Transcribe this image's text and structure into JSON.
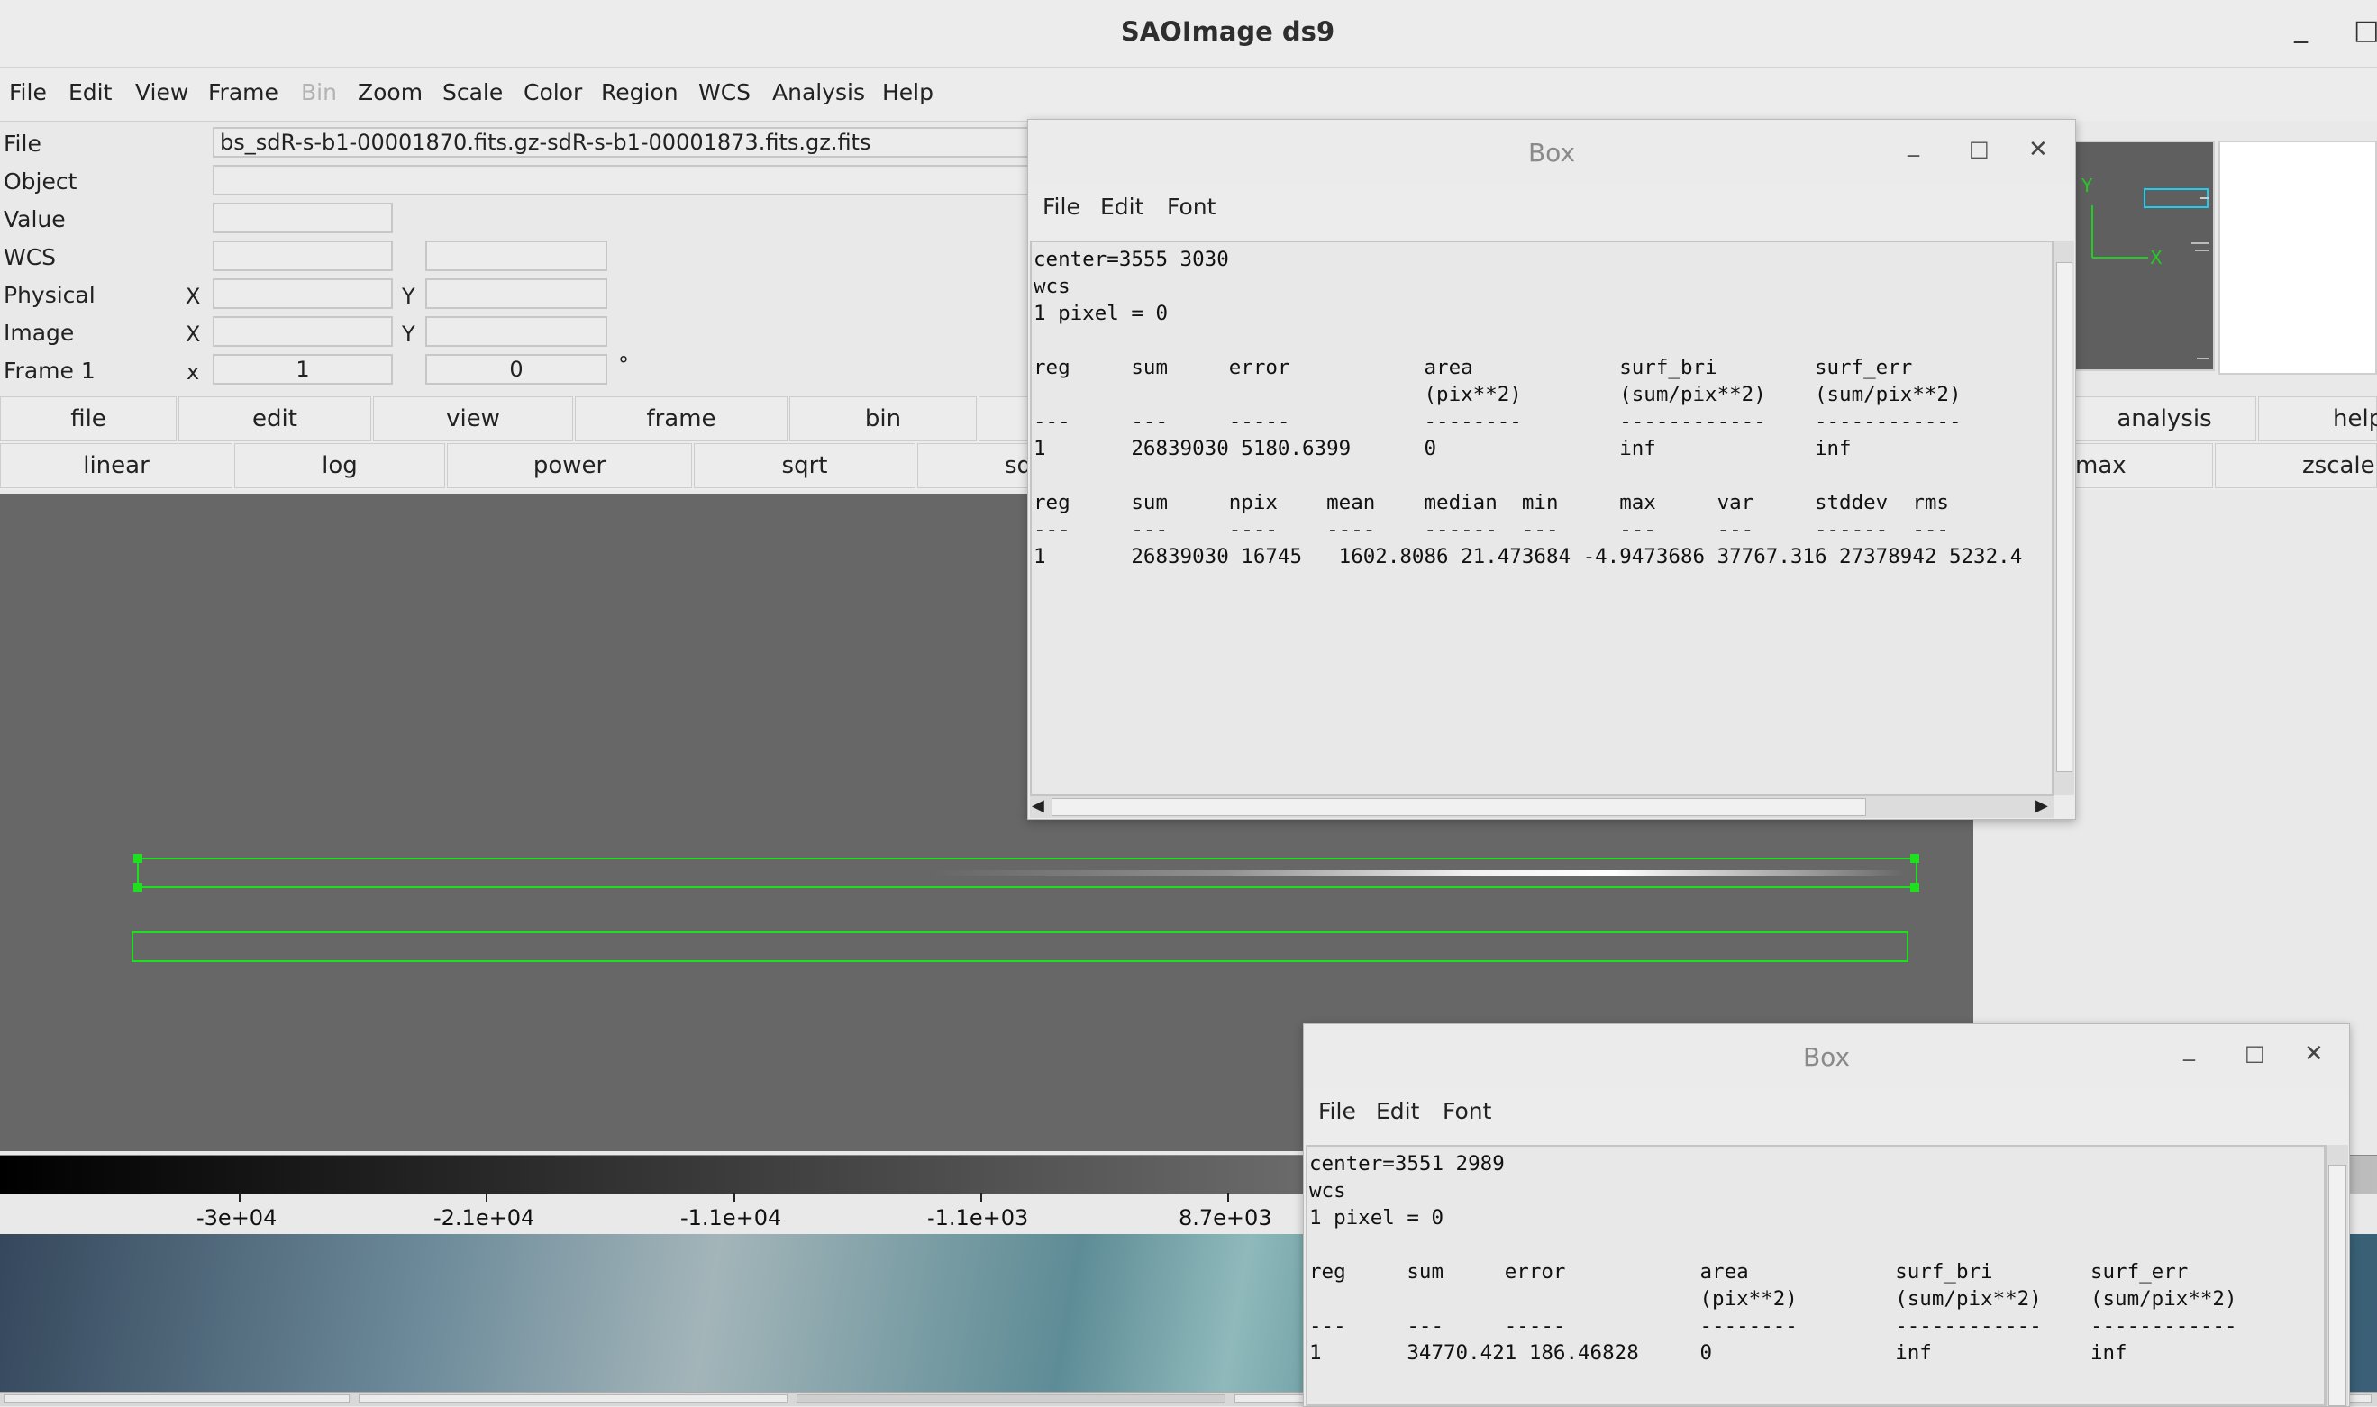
{
  "window": {
    "title": "SAOImage ds9",
    "minimize": "_",
    "maximize": "□"
  },
  "menubar": [
    "File",
    "Edit",
    "View",
    "Frame",
    "Bin",
    "Zoom",
    "Scale",
    "Color",
    "Region",
    "WCS",
    "Analysis",
    "Help"
  ],
  "info": {
    "file_label": "File",
    "file_value": "bs_sdR-s-b1-00001870.fits.gz-sdR-s-b1-00001873.fits.gz.fits",
    "object_label": "Object",
    "value_label": "Value",
    "wcs_label": "WCS",
    "physical_label": "Physical",
    "image_label": "Image",
    "frame_label": "Frame 1",
    "x_label": "X",
    "y_label": "Y",
    "frame_x_label": "x",
    "frame_x_value": "1",
    "frame_angle_value": "0",
    "degree": "°"
  },
  "buttonbar1": [
    "file",
    "edit",
    "view",
    "frame",
    "bin",
    "analysis",
    "help"
  ],
  "buttonbar2": [
    "linear",
    "log",
    "power",
    "sqrt",
    "sq",
    "max",
    "zscale"
  ],
  "colorbar_ticks": [
    "-3e+04",
    "-2.1e+04",
    "-1.1e+04",
    "-1.1e+03",
    "8.7e+03"
  ],
  "panner": {
    "y_axis": "Y",
    "x_axis": "X"
  },
  "dialog1": {
    "title": "Box",
    "menu": [
      "File",
      "Edit",
      "Font"
    ],
    "close": "✕",
    "lines": [
      "center=3555 3030",
      "wcs",
      "1 pixel = 0",
      "",
      "reg     sum     error           area            surf_bri        surf_err",
      "                                (pix**2)        (sum/pix**2)    (sum/pix**2)",
      "---     ---     -----           --------        ------------    ------------",
      "1       26839030 5180.6399      0               inf             inf",
      "",
      "reg     sum     npix    mean    median  min     max     var     stddev  rms",
      "---     ---     ----    ----    ------  ---     ---     ---     ------  ---",
      "1       26839030 16745   1602.8086 21.473684 -4.9473686 37767.316 27378942 5232.4"
    ]
  },
  "dialog2": {
    "title": "Box",
    "menu": [
      "File",
      "Edit",
      "Font"
    ],
    "close": "✕",
    "lines": [
      "center=3551 2989",
      "wcs",
      "1 pixel = 0",
      "",
      "reg     sum     error           area            surf_bri        surf_err",
      "                                (pix**2)        (sum/pix**2)    (sum/pix**2)",
      "---     ---     -----           --------        ------------    ------------",
      "1       34770.421 186.46828     0               inf             inf"
    ]
  }
}
